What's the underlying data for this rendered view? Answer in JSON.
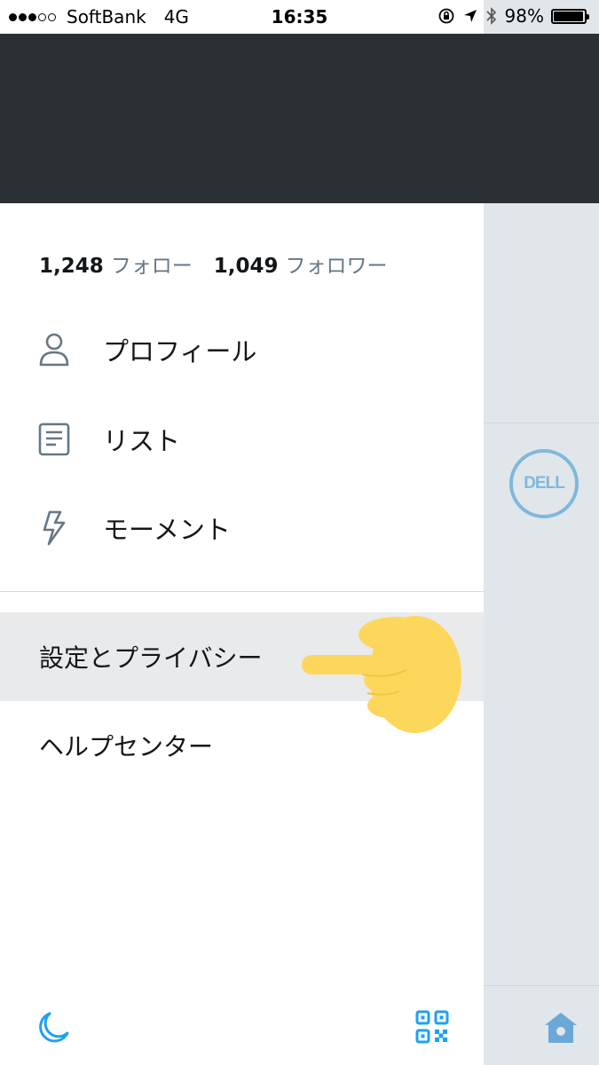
{
  "status_bar": {
    "carrier": "SoftBank",
    "network": "4G",
    "time": "16:35",
    "battery": "98%",
    "battery_level": 0.98,
    "signal_bars_filled": 3,
    "signal_bars_total": 5,
    "icons": [
      "rotation-lock-icon",
      "location-arrow-icon",
      "bluetooth-icon",
      "battery-icon"
    ]
  },
  "profile": {
    "following_count": "1,248",
    "following_label": "フォロー",
    "followers_count": "1,049",
    "followers_label": "フォロワー"
  },
  "menu": {
    "items": [
      {
        "label": "プロフィール",
        "icon": "person-icon"
      },
      {
        "label": "リスト",
        "icon": "list-icon"
      },
      {
        "label": "モーメント",
        "icon": "lightning-icon"
      }
    ],
    "secondary": [
      {
        "label": "設定とプライバシー",
        "highlighted": true
      },
      {
        "label": "ヘルプセンター",
        "highlighted": false
      }
    ]
  },
  "background": {
    "avatar_text": "DELL"
  },
  "colors": {
    "header_bg": "#2b3035",
    "accent": "#1da1f2",
    "muted_text": "#657786",
    "icon_gray": "#657786",
    "highlight_bg": "#e9eaeb",
    "pointer_yellow": "#fdd75c",
    "strip_bg": "#e1e6ea"
  },
  "bottom_bar": {
    "icons": [
      "night-mode-moon-icon",
      "qr-code-icon"
    ]
  }
}
